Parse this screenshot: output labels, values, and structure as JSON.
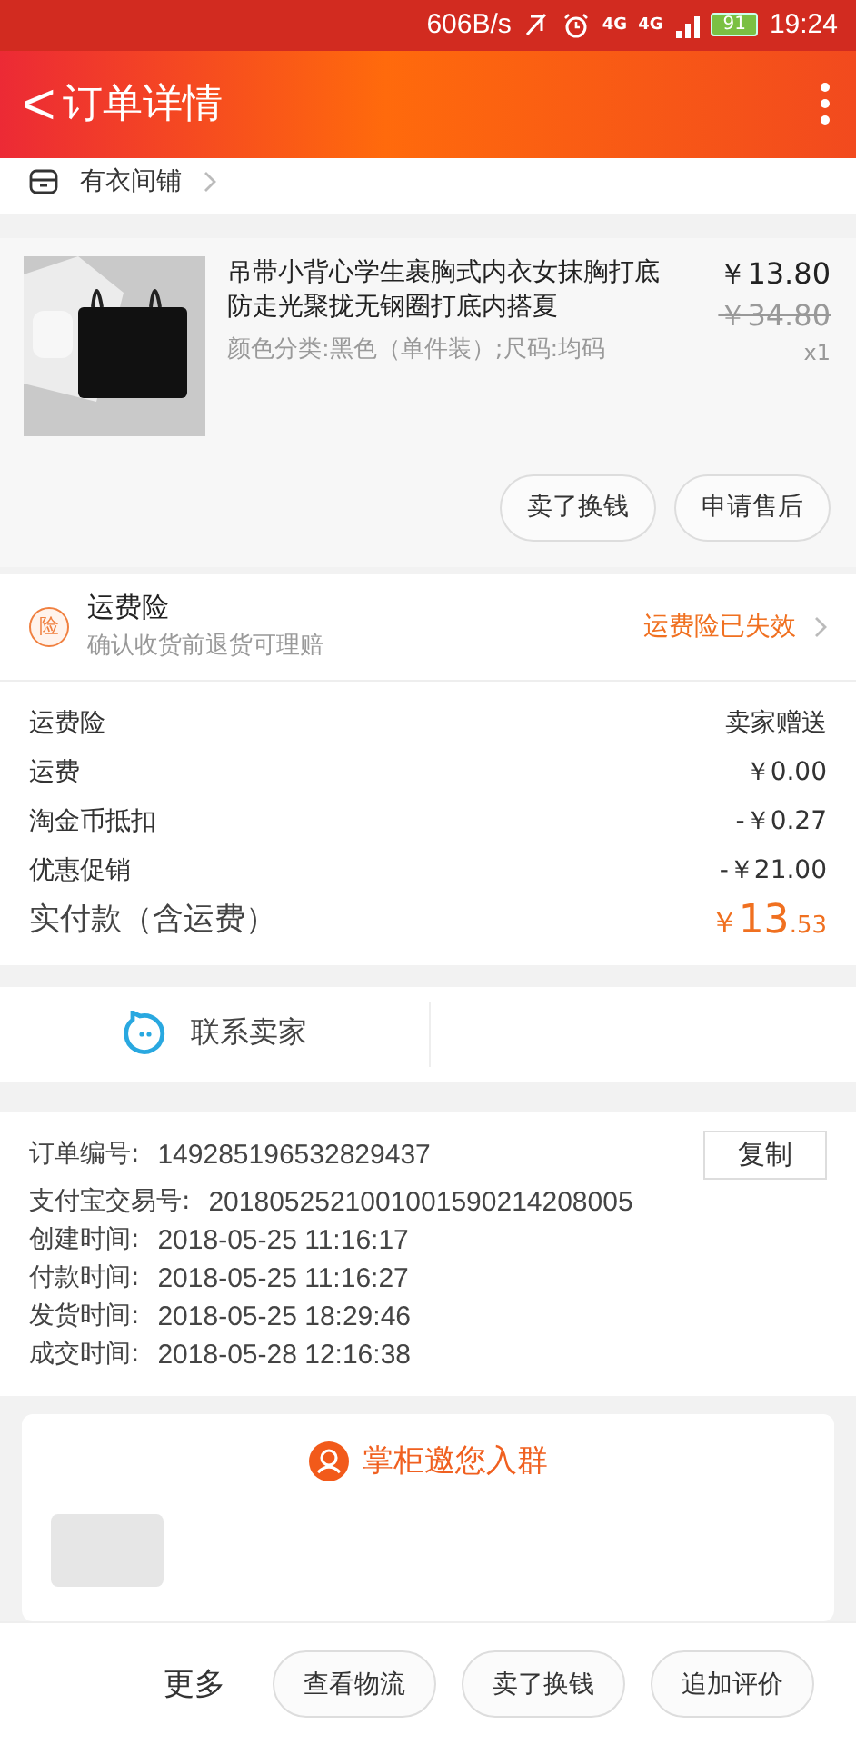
{
  "status_bar": {
    "speed": "606B/s",
    "network_labels": [
      "4G",
      "4G"
    ],
    "battery": "91",
    "time": "19:24"
  },
  "header": {
    "back": "<",
    "title": "订单详情"
  },
  "shop": {
    "name": "有衣间铺"
  },
  "product": {
    "title": "吊带小背心学生裹胸式内衣女抹胸打底防走光聚拢无钢圈打底内搭夏",
    "sku": "颜色分类:黑色（单件装）;尺码:均码",
    "price": "￥13.80",
    "original_price": "￥34.80",
    "quantity": "x1",
    "buttons": [
      "卖了换钱",
      "申请售后"
    ]
  },
  "insurance": {
    "badge": "险",
    "title": "运费险",
    "subtitle": "确认收货前退货可理赔",
    "status": "运费险已失效"
  },
  "fees": [
    {
      "label": "运费险",
      "value": "卖家赠送"
    },
    {
      "label": "运费",
      "value": "￥0.00"
    },
    {
      "label": "淘金币抵扣",
      "value": "-￥0.27"
    },
    {
      "label": "优惠促销",
      "value": "-￥21.00"
    }
  ],
  "total": {
    "label": "实付款（含运费）",
    "currency": "￥",
    "integer": "13",
    "decimal": ".53"
  },
  "contact": {
    "label": "联系卖家"
  },
  "order_info": {
    "copy_button": "复制",
    "rows": [
      {
        "label": "订单编号:",
        "value": "149285196532829437"
      },
      {
        "label": "支付宝交易号:",
        "value": "2018052521001001590214208005"
      },
      {
        "label": "创建时间:",
        "value": "2018-05-25 11:16:17"
      },
      {
        "label": "付款时间:",
        "value": "2018-05-25 11:16:27"
      },
      {
        "label": "发货时间:",
        "value": "2018-05-25 18:29:46"
      },
      {
        "label": "成交时间:",
        "value": "2018-05-28 12:16:38"
      }
    ]
  },
  "group_invite": {
    "title": "掌柜邀您入群"
  },
  "bottom_bar": {
    "more": "更多",
    "buttons": [
      "查看物流",
      "卖了换钱",
      "追加评价"
    ]
  }
}
